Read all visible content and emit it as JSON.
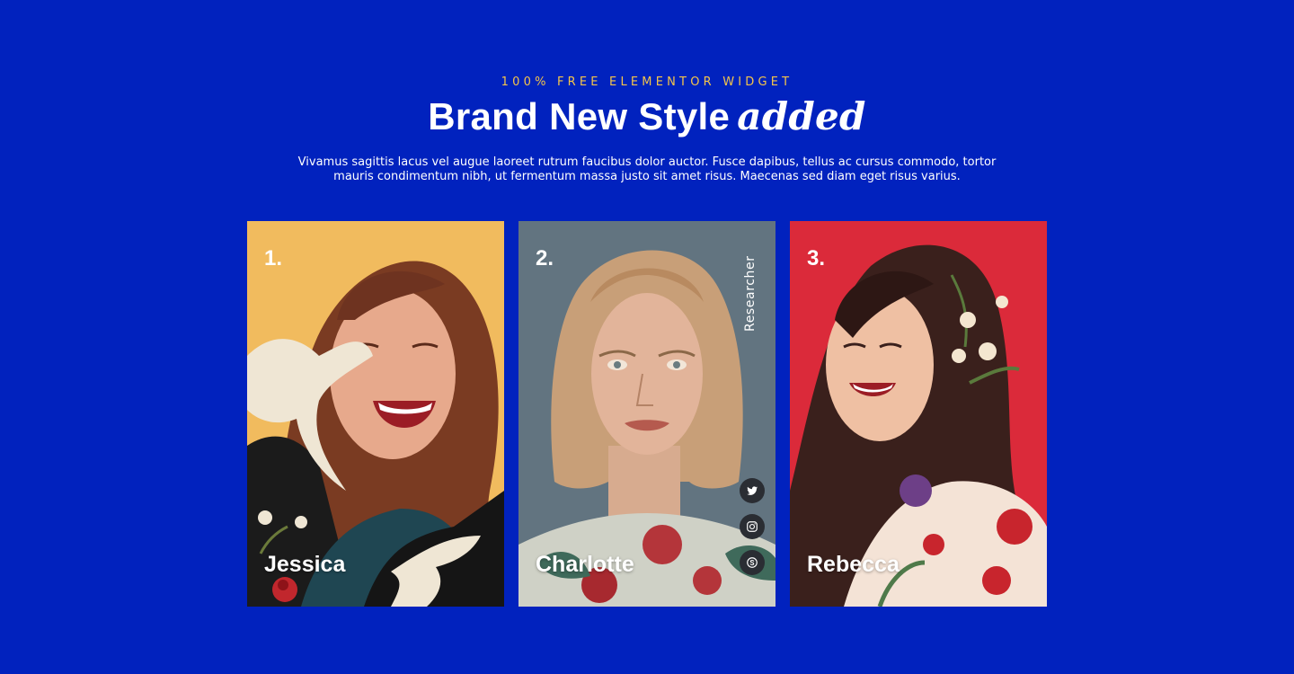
{
  "header": {
    "eyebrow": "100% FREE ELEMENTOR WIDGET",
    "title_bold": "Brand New Style",
    "title_italic": "added",
    "description": "Vivamus sagittis lacus vel augue laoreet rutrum faucibus dolor auctor. Fusce dapibus, tellus ac cursus commodo, tortor mauris condimentum nibh, ut fermentum massa justo sit amet risus. Maecenas sed diam eget risus varius."
  },
  "colors": {
    "background": "#0122be",
    "eyebrow": "#f4c54a",
    "card1_bg": "#f1bb5e",
    "card2_bg": "#627480",
    "card3_bg": "#db2a3a"
  },
  "team": [
    {
      "number": "1.",
      "name": "Jessica",
      "role": "",
      "image": "illustrated-portrait-laughing-woman-with-doves-icon"
    },
    {
      "number": "2.",
      "name": "Charlotte",
      "role": "Researcher",
      "image": "illustrated-portrait-blonde-woman-icon",
      "social": [
        {
          "icon": "twitter-icon"
        },
        {
          "icon": "instagram-icon"
        },
        {
          "icon": "skype-icon"
        }
      ]
    },
    {
      "number": "3.",
      "name": "Rebecca",
      "role": "",
      "image": "illustrated-portrait-smiling-woman-with-flowers-icon"
    }
  ]
}
